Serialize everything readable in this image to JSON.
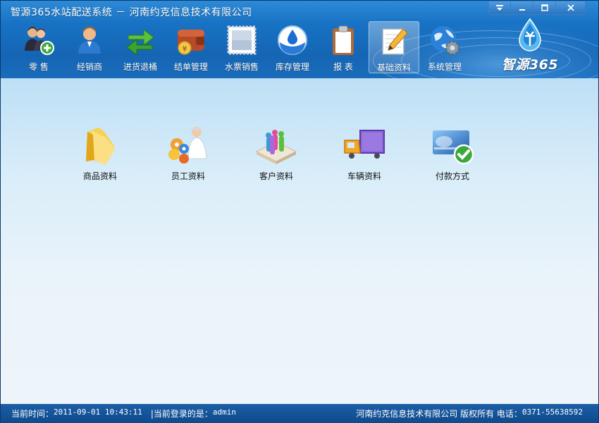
{
  "window": {
    "title": "智源365水站配送系统  －  河南约克信息技术有限公司",
    "controls": [
      "menu-icon",
      "minimize-icon",
      "maximize-icon",
      "close-icon"
    ]
  },
  "toolbar": {
    "items": [
      {
        "label": "零  售",
        "icon": "retail-people-add-icon"
      },
      {
        "label": "经销商",
        "icon": "dealer-person-icon"
      },
      {
        "label": "进货退桶",
        "icon": "exchange-arrows-icon"
      },
      {
        "label": "结单管理",
        "icon": "wallet-icon"
      },
      {
        "label": "水票销售",
        "icon": "stamp-ticket-icon"
      },
      {
        "label": "库存管理",
        "icon": "water-drop-globe-icon"
      },
      {
        "label": "报  表",
        "icon": "clipboard-icon"
      },
      {
        "label": "基础资料",
        "icon": "notepad-pencil-icon",
        "active": true
      },
      {
        "label": "系统管理",
        "icon": "globe-gear-icon"
      }
    ]
  },
  "logo": {
    "text": "智源365"
  },
  "modules": [
    {
      "label": "商品资料",
      "icon": "folder-icon"
    },
    {
      "label": "员工资料",
      "icon": "workers-icon"
    },
    {
      "label": "客户资料",
      "icon": "customers-icon"
    },
    {
      "label": "车辆资料",
      "icon": "vehicle-icon"
    },
    {
      "label": "付款方式",
      "icon": "payment-card-check-icon"
    }
  ],
  "status": {
    "time_label": "当前时间：",
    "time_value": "2011-09-01 10:43:11",
    "user_label": "|当前登录的是：",
    "user_value": "admin",
    "company": "河南约克信息技术有限公司 版权所有 电话：",
    "phone": "0371-55638592"
  },
  "colors": {
    "accent": "#1565b4",
    "status_bar": "#0f4a8c",
    "content_bg": "#e9f3fa"
  }
}
